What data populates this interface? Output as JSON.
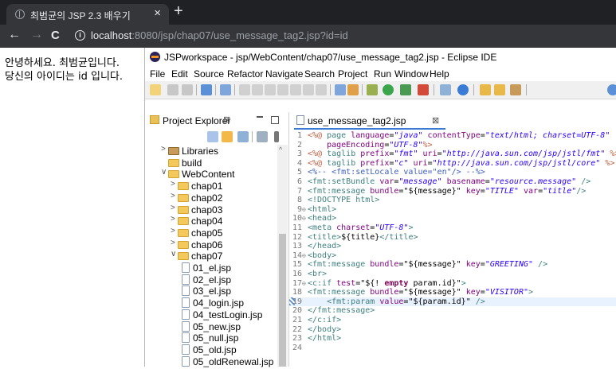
{
  "browser": {
    "tab_title": "최범균의 JSP 2.3 배우기",
    "tab_close": "×",
    "new_tab": "+",
    "back": "←",
    "forward": "→",
    "reload": "C",
    "info": "i",
    "url_host": "localhost",
    "url_rest": ":8080/jsp/chap07/use_message_tag2.jsp?id=id"
  },
  "page": {
    "line1": "안녕하세요. 최범균입니다.",
    "line2": "당신의 아이디는 id 입니다."
  },
  "eclipse": {
    "title": "JSPworkspace - jsp/WebContent/chap07/use_message_tag2.jsp - Eclipse IDE",
    "menu": [
      "File",
      "Edit",
      "Source",
      "Refactor",
      "Navigate",
      "Search",
      "Project",
      "Run",
      "Window",
      "Help"
    ],
    "project_explorer": {
      "title": "Project Explorer",
      "close": "⊠",
      "tree": [
        {
          "label": "Libraries",
          "type": "lib",
          "arrow": ">"
        },
        {
          "label": "build",
          "type": "folder",
          "arrow": ""
        },
        {
          "label": "WebContent",
          "type": "folder",
          "arrow": "v"
        },
        {
          "label": "chap01",
          "type": "folder",
          "arrow": ">"
        },
        {
          "label": "chap02",
          "type": "folder",
          "arrow": ">"
        },
        {
          "label": "chap03",
          "type": "folder",
          "arrow": ">"
        },
        {
          "label": "chap04",
          "type": "folder",
          "arrow": ">"
        },
        {
          "label": "chap05",
          "type": "folder",
          "arrow": ">"
        },
        {
          "label": "chap06",
          "type": "folder",
          "arrow": ">"
        },
        {
          "label": "chap07",
          "type": "folder",
          "arrow": "v"
        },
        {
          "label": "01_el.jsp",
          "type": "file",
          "arrow": ""
        },
        {
          "label": "02_el.jsp",
          "type": "file",
          "arrow": ""
        },
        {
          "label": "03_el.jsp",
          "type": "file",
          "arrow": ""
        },
        {
          "label": "04_login.jsp",
          "type": "file",
          "arrow": ""
        },
        {
          "label": "04_testLogin.jsp",
          "type": "file",
          "arrow": ""
        },
        {
          "label": "05_new.jsp",
          "type": "file",
          "arrow": ""
        },
        {
          "label": "05_null.jsp",
          "type": "file",
          "arrow": ""
        },
        {
          "label": "05_old.jsp",
          "type": "file",
          "arrow": ""
        },
        {
          "label": "05_oldRenewal.jsp",
          "type": "file",
          "arrow": ""
        }
      ]
    },
    "editor": {
      "tab_title": "use_message_tag2.jsp",
      "tab_close": "⊠",
      "lines": [
        {
          "n": "1",
          "fold": "",
          "tokens": [
            [
              "t-jsp",
              "<%@ "
            ],
            [
              "t-tag",
              "page "
            ],
            [
              "t-attr",
              "language"
            ],
            [
              "",
              "="
            ],
            [
              "t-str",
              "\"java\""
            ],
            [
              "t-attr",
              " contentType"
            ],
            [
              "",
              "="
            ],
            [
              "t-str",
              "\"text/html; charset=UTF-8\""
            ]
          ]
        },
        {
          "n": "2",
          "fold": "",
          "tokens": [
            [
              "t-attr",
              "    pageEncoding"
            ],
            [
              "",
              "="
            ],
            [
              "t-str",
              "\"UTF-8\""
            ],
            [
              "t-jsp",
              "%>"
            ]
          ]
        },
        {
          "n": "3",
          "fold": "",
          "tokens": [
            [
              "t-jsp",
              "<%@ "
            ],
            [
              "t-tag",
              "taglib "
            ],
            [
              "t-attr",
              "prefix"
            ],
            [
              "",
              "="
            ],
            [
              "t-str",
              "\"fmt\""
            ],
            [
              "t-attr",
              " uri"
            ],
            [
              "",
              "="
            ],
            [
              "t-str",
              "\"http://java.sun.com/jsp/jstl/fmt\""
            ],
            [
              "t-jsp",
              " %>"
            ]
          ]
        },
        {
          "n": "4",
          "fold": "",
          "tokens": [
            [
              "t-jsp",
              "<%@ "
            ],
            [
              "t-tag",
              "taglib "
            ],
            [
              "t-attr",
              "prefix"
            ],
            [
              "",
              "="
            ],
            [
              "t-str",
              "\"c\""
            ],
            [
              "t-attr",
              " uri"
            ],
            [
              "",
              "="
            ],
            [
              "t-str",
              "\"http://java.sun.com/jsp/jstl/core\""
            ],
            [
              "t-jsp",
              " %>"
            ]
          ]
        },
        {
          "n": "5",
          "fold": "",
          "tokens": [
            [
              "t-cmt",
              "<%-- <fmt:setLocale value=\"en\"/> --%>"
            ]
          ]
        },
        {
          "n": "6",
          "fold": "",
          "tokens": [
            [
              "t-tag",
              "<fmt:setBundle "
            ],
            [
              "t-attr",
              "var"
            ],
            [
              "",
              "="
            ],
            [
              "t-str",
              "\"message\""
            ],
            [
              "t-attr",
              " basename"
            ],
            [
              "",
              "="
            ],
            [
              "t-str",
              "\"resource.message\""
            ],
            [
              "t-tag",
              " />"
            ]
          ]
        },
        {
          "n": "7",
          "fold": "",
          "tokens": [
            [
              "t-tag",
              "<fmt:message "
            ],
            [
              "t-attr",
              "bundle"
            ],
            [
              "",
              "=\"${message}\""
            ],
            [
              "t-attr",
              " key"
            ],
            [
              "",
              "="
            ],
            [
              "t-str",
              "\"TITLE\""
            ],
            [
              "t-attr",
              " var"
            ],
            [
              "",
              "="
            ],
            [
              "t-str",
              "\"title\""
            ],
            [
              "t-tag",
              "/>"
            ]
          ]
        },
        {
          "n": "8",
          "fold": "",
          "tokens": [
            [
              "t-tag",
              "<!DOCTYPE html>"
            ]
          ]
        },
        {
          "n": "9",
          "fold": "⊖",
          "tokens": [
            [
              "t-tag",
              "<html>"
            ]
          ]
        },
        {
          "n": "10",
          "fold": "⊖",
          "tokens": [
            [
              "t-tag",
              "<head>"
            ]
          ]
        },
        {
          "n": "11",
          "fold": "",
          "tokens": [
            [
              "t-tag",
              "<meta "
            ],
            [
              "t-attr",
              "charset"
            ],
            [
              "",
              "="
            ],
            [
              "t-str",
              "\"UTF-8\""
            ],
            [
              "t-tag",
              ">"
            ]
          ]
        },
        {
          "n": "12",
          "fold": "",
          "tokens": [
            [
              "t-tag",
              "<title>"
            ],
            [
              "",
              "${title}"
            ],
            [
              "t-tag",
              "</title>"
            ]
          ]
        },
        {
          "n": "13",
          "fold": "",
          "tokens": [
            [
              "t-tag",
              "</head>"
            ]
          ]
        },
        {
          "n": "14",
          "fold": "⊖",
          "tokens": [
            [
              "t-tag",
              "<body>"
            ]
          ]
        },
        {
          "n": "15",
          "fold": "",
          "tokens": [
            [
              "t-tag",
              "<fmt:message "
            ],
            [
              "t-attr",
              "bundle"
            ],
            [
              "",
              "=\"${message}\""
            ],
            [
              "t-attr",
              " key"
            ],
            [
              "",
              "="
            ],
            [
              "t-str",
              "\"GREETING\""
            ],
            [
              "t-tag",
              " />"
            ]
          ]
        },
        {
          "n": "16",
          "fold": "",
          "tokens": [
            [
              "t-tag",
              "<br>"
            ]
          ]
        },
        {
          "n": "17",
          "fold": "⊖",
          "tokens": [
            [
              "t-tag",
              "<c:if "
            ],
            [
              "t-attr",
              "test"
            ],
            [
              "",
              "=\"${! "
            ],
            [
              "t-kw",
              "empty"
            ],
            [
              "",
              " param.id}\""
            ],
            [
              "t-tag",
              ">"
            ]
          ]
        },
        {
          "n": "18",
          "fold": "",
          "tokens": [
            [
              "t-tag",
              "<fmt:message "
            ],
            [
              "t-attr",
              "bundle"
            ],
            [
              "",
              "=\"${message}\""
            ],
            [
              "t-attr",
              " key"
            ],
            [
              "",
              "="
            ],
            [
              "t-str",
              "\"VISITOR\""
            ],
            [
              "t-tag",
              ">"
            ]
          ]
        },
        {
          "n": "19",
          "fold": "",
          "tokens": [
            [
              "t-tag",
              "    <fmt:param "
            ],
            [
              "t-attr",
              "value"
            ],
            [
              "",
              "=\"${param.id}\""
            ],
            [
              "t-tag",
              " />"
            ]
          ]
        },
        {
          "n": "20",
          "fold": "",
          "tokens": [
            [
              "t-tag",
              "</fmt:message>"
            ]
          ]
        },
        {
          "n": "21",
          "fold": "",
          "tokens": [
            [
              "t-tag",
              "</c:if>"
            ]
          ]
        },
        {
          "n": "22",
          "fold": "",
          "tokens": [
            [
              "t-tag",
              "</body>"
            ]
          ]
        },
        {
          "n": "23",
          "fold": "",
          "tokens": [
            [
              "t-tag",
              "</html>"
            ]
          ]
        },
        {
          "n": "24",
          "fold": "",
          "tokens": []
        }
      ]
    }
  }
}
